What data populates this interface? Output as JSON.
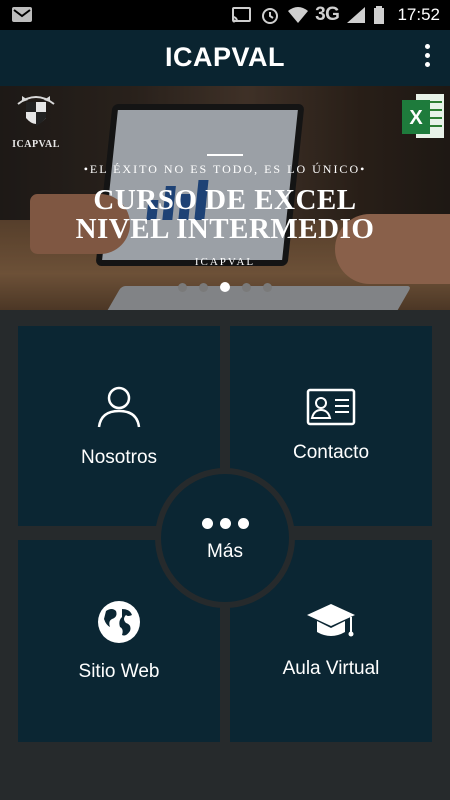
{
  "status_bar": {
    "network": "3G",
    "time": "17:52"
  },
  "app_bar": {
    "title": "ICAPVAL"
  },
  "banner": {
    "logo_text": "ICAPVAL",
    "tagline": "•EL ÉXITO NO ES TODO, ES LO ÚNICO•",
    "headline_line1": "CURSO DE EXCEL",
    "headline_line2": "NIVEL INTERMEDIO",
    "brand": "ICAPVAL",
    "excel_badge": "X",
    "slides_count": 5,
    "active_slide": 3
  },
  "menu": {
    "tiles": [
      {
        "label": "Nosotros",
        "icon": "person-icon"
      },
      {
        "label": "Contacto",
        "icon": "contact-card-icon"
      },
      {
        "label": "Sitio Web",
        "icon": "globe-icon"
      },
      {
        "label": "Aula Virtual",
        "icon": "graduation-cap-icon"
      }
    ],
    "center": {
      "label": "Más",
      "icon": "more-dots-icon"
    }
  },
  "colors": {
    "app_bar": "#0a2430",
    "tile": "#0b2633",
    "grid_background": "#262a2c"
  }
}
